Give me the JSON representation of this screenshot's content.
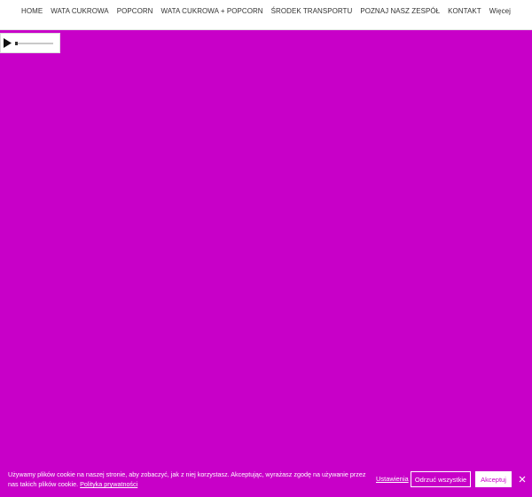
{
  "colors": {
    "accent": "#c800c8",
    "nav_text": "#333333",
    "header_bg": "#ffffff",
    "banner_text": "#ffffff"
  },
  "nav": {
    "items": [
      {
        "label": "HOME"
      },
      {
        "label": "WATA CUKROWA"
      },
      {
        "label": "POPCORN"
      },
      {
        "label": "WATA CUKROWA + POPCORN"
      },
      {
        "label": "ŚRODEK TRANSPORTU"
      },
      {
        "label": "POZNAJ NASZ ZESPÓŁ"
      },
      {
        "label": "KONTAKT"
      }
    ],
    "more_label": "Więcej"
  },
  "player": {
    "play_icon": "play-icon",
    "progress": 0
  },
  "cookie_banner": {
    "text": "Używamy plików cookie na naszej stronie, aby zobaczyć, jak z niej korzystasz. Akceptując, wyrażasz zgodę na używanie przez nas takich plików cookie.",
    "policy_link": "Polityka prywatności",
    "settings_label": "Ustawienia",
    "reject_label": "Odrzuć wszystkie",
    "accept_label": "Akceptuj",
    "close_icon": "close-icon"
  }
}
